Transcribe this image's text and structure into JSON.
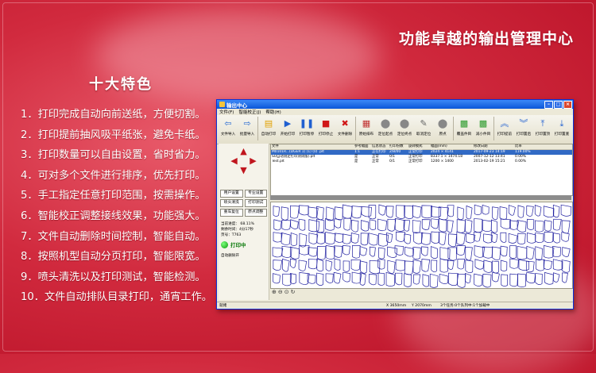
{
  "headline": "功能卓越的输出管理中心",
  "features_title": "十大特色",
  "features": [
    "1．打印完成自动向前送纸，方便切割。",
    "2．打印提前抽风吸平纸张，避免卡纸。",
    "3．打印数量可以自由设置，省时省力。",
    "4．可对多个文件进行排序，优先打印。",
    "5．手工指定任意打印范围，按需操作。",
    "6．智能校正调整接线效果，功能强大。",
    "7．文件自动删除时间控制，智能自动。",
    "8．按照机型自动分页打印，智能限宽。",
    "9．喷头清洗以及打印测试，智能检测。",
    "10．文件自动排队目录打印，通宵工作。"
  ],
  "window": {
    "title": "输出中心",
    "menu": [
      "文件(F)",
      "智能校正(J)",
      "帮助(H)"
    ],
    "toolbar": [
      {
        "label": "文件导入",
        "icon": "import-icon",
        "glyph": "⇦",
        "color": "#2a6bd0"
      },
      {
        "label": "批量导入",
        "icon": "batch-import-icon",
        "glyph": "⇨",
        "color": "#2a6bd0"
      },
      {
        "label": "自动打印",
        "icon": "auto-print-icon",
        "glyph": "▤",
        "color": "#e0a000"
      },
      {
        "label": "开始打印",
        "icon": "play-icon",
        "glyph": "▶",
        "color": "#1f5fd0"
      },
      {
        "label": "打印暂停",
        "icon": "pause-icon",
        "glyph": "❚❚",
        "color": "#1f5fd0"
      },
      {
        "label": "打印停止",
        "icon": "stop-icon",
        "glyph": "■",
        "color": "#d01818"
      },
      {
        "label": "文件删除",
        "icon": "delete-icon",
        "glyph": "✖",
        "color": "#d01818"
      },
      {
        "label": "原始排布",
        "icon": "layout-icon",
        "glyph": "▦",
        "color": "#c03030"
      },
      {
        "label": "定位起点",
        "icon": "pin-start-icon",
        "glyph": "⬤",
        "color": "#888888"
      },
      {
        "label": "定位终点",
        "icon": "pin-end-icon",
        "glyph": "⬤",
        "color": "#888888"
      },
      {
        "label": "取消定位",
        "icon": "cancel-pin-icon",
        "glyph": "✎",
        "color": "#666666"
      },
      {
        "label": "原点",
        "icon": "origin-icon",
        "glyph": "⬤",
        "color": "#888888"
      },
      {
        "label": "覆盖件目",
        "icon": "cover-icon",
        "glyph": "▩",
        "color": "#2a9a2a"
      },
      {
        "label": "减小件目",
        "icon": "reduce-icon",
        "glyph": "▩",
        "color": "#2a9a2a"
      },
      {
        "label": "打印提前",
        "icon": "move-up-icon",
        "glyph": "︽",
        "color": "#1f5fd0"
      },
      {
        "label": "打印置后",
        "icon": "move-down-icon",
        "glyph": "︾",
        "color": "#1f5fd0"
      },
      {
        "label": "打印置顶",
        "icon": "top-icon",
        "glyph": "⤒",
        "color": "#1f5fd0"
      },
      {
        "label": "打印置底",
        "icon": "bottom-icon",
        "glyph": "⤓",
        "color": "#1f5fd0"
      }
    ],
    "left_buttons": [
      "用户设置",
      "专业设置",
      "喷头清洗",
      "打印测试",
      "重车复位",
      "原点调整"
    ],
    "stats": [
      "当前进度：  68.11%",
      "剩余时间：4分17秒",
      "页号：T763"
    ],
    "printing_label": "打印中",
    "auto_delete_label": "自动删除开",
    "file_table": {
      "headers": [
        "文件",
        "参考幅面",
        "信息状态",
        "打印份数",
        "旋转模式",
        "幅面(mm)",
        "修改日期",
        "比率"
      ],
      "rows": [
        [
          "M0101R...(DGER 1)  (1)  (0)  .plt",
          "1:1",
          "正在打印",
          "2/8/00",
          "正常打印",
          "2024 × 4141",
          "2017-09-23  14:19",
          "119.00%"
        ],
        [
          "SU自动测定打印测试版).plt",
          "是",
          "正常",
          "0/1",
          "正常打印",
          "8337.1 × 1474.18",
          "2007-12-12  13:41",
          "0.00%"
        ],
        [
          "Test.plt",
          "是",
          "正常",
          "0/1",
          "正常打印",
          "1200 × 1400",
          "2013-02-19  15:21",
          "0.00%"
        ]
      ]
    },
    "zoom_icons": [
      "zoom-in-icon",
      "zoom-out-icon",
      "zoom-fit-icon",
      "refresh-icon"
    ],
    "status": {
      "left": "就绪",
      "dim1": "X 3650mm",
      "dim2": "Y 2070mm",
      "info": "3个任务:0个队列中:1个加载中"
    }
  }
}
